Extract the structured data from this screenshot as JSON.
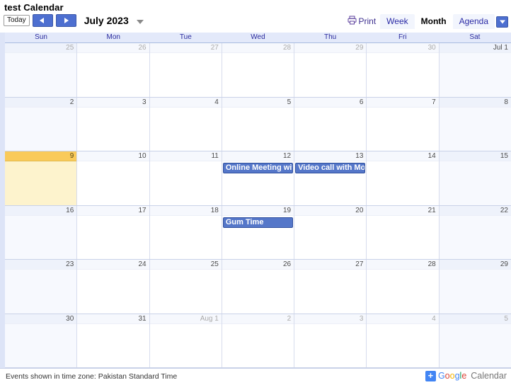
{
  "header": {
    "calendar_title": "test Calendar",
    "today_button": "Today",
    "prev_icon": "left-arrow-icon",
    "next_icon": "right-arrow-icon",
    "period_label": "July 2023",
    "period_caret_icon": "chevron-down-icon",
    "print_label": "Print",
    "print_icon": "printer-icon",
    "views": [
      {
        "label": "Week",
        "selected": false
      },
      {
        "label": "Month",
        "selected": true
      },
      {
        "label": "Agenda",
        "selected": false
      }
    ],
    "agenda_caret_icon": "chevron-down-icon"
  },
  "grid": {
    "day_names": [
      "Sun",
      "Mon",
      "Tue",
      "Wed",
      "Thu",
      "Fri",
      "Sat"
    ],
    "weeks": [
      [
        {
          "num": "25",
          "other_month": true,
          "today": false,
          "events": []
        },
        {
          "num": "26",
          "other_month": true,
          "today": false,
          "events": []
        },
        {
          "num": "27",
          "other_month": true,
          "today": false,
          "events": []
        },
        {
          "num": "28",
          "other_month": true,
          "today": false,
          "events": []
        },
        {
          "num": "29",
          "other_month": true,
          "today": false,
          "events": []
        },
        {
          "num": "30",
          "other_month": true,
          "today": false,
          "events": []
        },
        {
          "num": "Jul 1",
          "other_month": false,
          "today": false,
          "events": []
        }
      ],
      [
        {
          "num": "2",
          "other_month": false,
          "today": false,
          "events": []
        },
        {
          "num": "3",
          "other_month": false,
          "today": false,
          "events": []
        },
        {
          "num": "4",
          "other_month": false,
          "today": false,
          "events": []
        },
        {
          "num": "5",
          "other_month": false,
          "today": false,
          "events": []
        },
        {
          "num": "6",
          "other_month": false,
          "today": false,
          "events": []
        },
        {
          "num": "7",
          "other_month": false,
          "today": false,
          "events": []
        },
        {
          "num": "8",
          "other_month": false,
          "today": false,
          "events": []
        }
      ],
      [
        {
          "num": "9",
          "other_month": false,
          "today": true,
          "events": []
        },
        {
          "num": "10",
          "other_month": false,
          "today": false,
          "events": []
        },
        {
          "num": "11",
          "other_month": false,
          "today": false,
          "events": []
        },
        {
          "num": "12",
          "other_month": false,
          "today": false,
          "events": [
            "Online Meeting wit"
          ]
        },
        {
          "num": "13",
          "other_month": false,
          "today": false,
          "events": [
            "Video call with Mor"
          ]
        },
        {
          "num": "14",
          "other_month": false,
          "today": false,
          "events": []
        },
        {
          "num": "15",
          "other_month": false,
          "today": false,
          "events": []
        }
      ],
      [
        {
          "num": "16",
          "other_month": false,
          "today": false,
          "events": []
        },
        {
          "num": "17",
          "other_month": false,
          "today": false,
          "events": []
        },
        {
          "num": "18",
          "other_month": false,
          "today": false,
          "events": []
        },
        {
          "num": "19",
          "other_month": false,
          "today": false,
          "events": [
            "Gum Time"
          ]
        },
        {
          "num": "20",
          "other_month": false,
          "today": false,
          "events": []
        },
        {
          "num": "21",
          "other_month": false,
          "today": false,
          "events": []
        },
        {
          "num": "22",
          "other_month": false,
          "today": false,
          "events": []
        }
      ],
      [
        {
          "num": "23",
          "other_month": false,
          "today": false,
          "events": []
        },
        {
          "num": "24",
          "other_month": false,
          "today": false,
          "events": []
        },
        {
          "num": "25",
          "other_month": false,
          "today": false,
          "events": []
        },
        {
          "num": "26",
          "other_month": false,
          "today": false,
          "events": []
        },
        {
          "num": "27",
          "other_month": false,
          "today": false,
          "events": []
        },
        {
          "num": "28",
          "other_month": false,
          "today": false,
          "events": []
        },
        {
          "num": "29",
          "other_month": false,
          "today": false,
          "events": []
        }
      ],
      [
        {
          "num": "30",
          "other_month": false,
          "today": false,
          "events": []
        },
        {
          "num": "31",
          "other_month": false,
          "today": false,
          "events": []
        },
        {
          "num": "Aug 1",
          "other_month": true,
          "today": false,
          "events": []
        },
        {
          "num": "2",
          "other_month": true,
          "today": false,
          "events": []
        },
        {
          "num": "3",
          "other_month": true,
          "today": false,
          "events": []
        },
        {
          "num": "4",
          "other_month": true,
          "today": false,
          "events": []
        },
        {
          "num": "5",
          "other_month": true,
          "today": false,
          "events": []
        }
      ]
    ]
  },
  "footer": {
    "timezone_note": "Events shown in time zone: Pakistan Standard Time",
    "logo_plus": "+",
    "logo_google_letters": [
      "G",
      "o",
      "o",
      "g",
      "l",
      "e"
    ],
    "logo_product": "Calendar"
  },
  "colors": {
    "event_fill": "#5577c9",
    "event_border": "#2f4f9e",
    "today_header": "#f9ca5b",
    "today_body": "#fdf3cd",
    "accent_blue": "#4d6fd0"
  }
}
